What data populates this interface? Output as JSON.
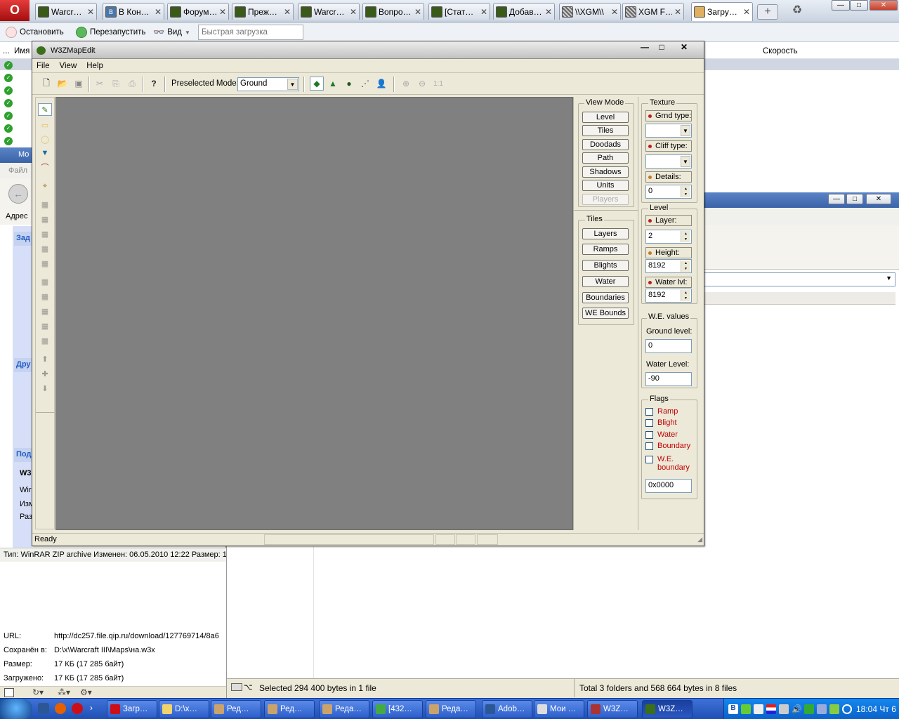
{
  "opera": {
    "menu_label": "O",
    "tabs": [
      {
        "label": "Warcr…",
        "icon": "wc"
      },
      {
        "label": "В Кон…",
        "icon": "vk"
      },
      {
        "label": "Форум…",
        "icon": "wc"
      },
      {
        "label": "Преж…",
        "icon": "wc"
      },
      {
        "label": "Warcr…",
        "icon": "wc"
      },
      {
        "label": "Вопро…",
        "icon": "wc"
      },
      {
        "label": "[Стат…",
        "icon": "wc"
      },
      {
        "label": "Добав…",
        "icon": "wc"
      },
      {
        "label": "\\\\XGM\\\\",
        "icon": "xg"
      },
      {
        "label": "XGM F…",
        "icon": "xg"
      },
      {
        "label": "Загру…",
        "icon": "dl"
      }
    ],
    "tab_close": "✕",
    "new_tab": "+",
    "toolbar": {
      "stop": "Остановить",
      "restart": "Перезапустить",
      "view": "Вид",
      "quick_placeholder": "Быстрая загрузка"
    },
    "columns": {
      "dots": "...",
      "name": "Имя",
      "speed": "Скорость"
    }
  },
  "explorer_left": {
    "title": "Мо",
    "menu_file": "Файл",
    "address_label": "Адрес",
    "sections": [
      "Зад",
      "Дру",
      "Под"
    ],
    "detail_lines": [
      "W3",
      "Wir",
      "Изм",
      "Раз"
    ],
    "status": "Тип: WinRAR ZIP archive Изменен: 06.05.2010 12:22 Размер: 1,",
    "details": [
      {
        "key": "URL:",
        "value": "http://dc257.file.qip.ru/download/127769714/8a6"
      },
      {
        "key": "Сохранён в:",
        "value": "D:\\x\\Warcraft III\\Maps\\на.w3x"
      },
      {
        "key": "Размер:",
        "value": "17 КБ (17 285 байт)"
      },
      {
        "key": "Загружено:",
        "value": "17 КБ (17 285 байт)"
      }
    ]
  },
  "explorer_right": {
    "status_left": "Selected 294 400 bytes in 1 file",
    "status_right": "Total 3 folders and 568 664 bytes in 8 files"
  },
  "w3z": {
    "title": "W3ZMapEdit",
    "menu": {
      "file": "File",
      "view": "View",
      "help": "Help"
    },
    "preselected_label": "Preselected Mode:",
    "preselected_value": "Ground",
    "zoom_11": "1:1",
    "view_mode": {
      "title": "View Mode",
      "buttons": [
        "Level",
        "Tiles",
        "Doodads",
        "Path",
        "Shadows",
        "Units",
        "Players"
      ]
    },
    "tiles": {
      "title": "Tiles",
      "buttons": [
        "Layers",
        "Ramps",
        "Blights",
        "Water",
        "Boundaries",
        "WE Bounds"
      ]
    },
    "texture": {
      "title": "Texture",
      "grnd_type": "Grnd type:",
      "cliff_type": "Cliff type:",
      "details": "Details:",
      "details_value": "0"
    },
    "level": {
      "title": "Level",
      "layer": "Layer:",
      "layer_value": "2",
      "height": "Height:",
      "height_value": "8192",
      "water_lvl": "Water lvl:",
      "water_lvl_value": "8192"
    },
    "we_values": {
      "title": "W.E. values",
      "ground_label": "Ground level:",
      "ground_value": "0",
      "water_label": "Water Level:",
      "water_value": "-90"
    },
    "flags": {
      "title": "Flags",
      "items": [
        "Ramp",
        "Blight",
        "Water",
        "Boundary"
      ],
      "we_boundary_1": "W.E.",
      "we_boundary_2": "boundary",
      "hex_value": "0x0000"
    },
    "status": "Ready"
  },
  "taskbar": {
    "tasks": [
      "Загр…",
      "D:\\x…",
      "Ред…",
      "Ред…",
      "Реда…",
      "[432…",
      "Реда…",
      "Adob…",
      "Мои …",
      "W3Z…",
      "W3Z…"
    ],
    "clock": "18:04 Чт 6"
  }
}
